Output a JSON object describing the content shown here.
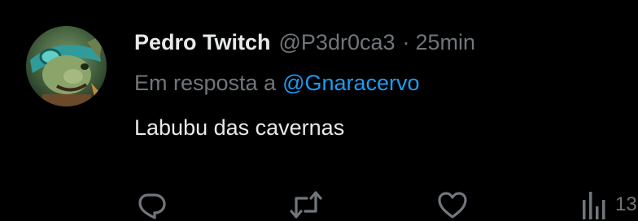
{
  "tweet": {
    "display_name": "Pedro Twitch",
    "handle": "@P3dr0ca3",
    "separator": "·",
    "time": "25min",
    "reply_prefix": "Em resposta a",
    "reply_to": "@Gnaracervo",
    "text": "Labubu das cavernas"
  },
  "actions": {
    "reply_icon": "speech-bubble-icon",
    "retweet_icon": "repost-arrows-icon",
    "like_icon": "heart-icon",
    "views_icon": "bar-chart-icon",
    "views_count": "13"
  },
  "colors": {
    "background": "#000000",
    "primary_text": "#e7e9ea",
    "secondary_text": "#71767b",
    "link": "#1d9bf0"
  }
}
